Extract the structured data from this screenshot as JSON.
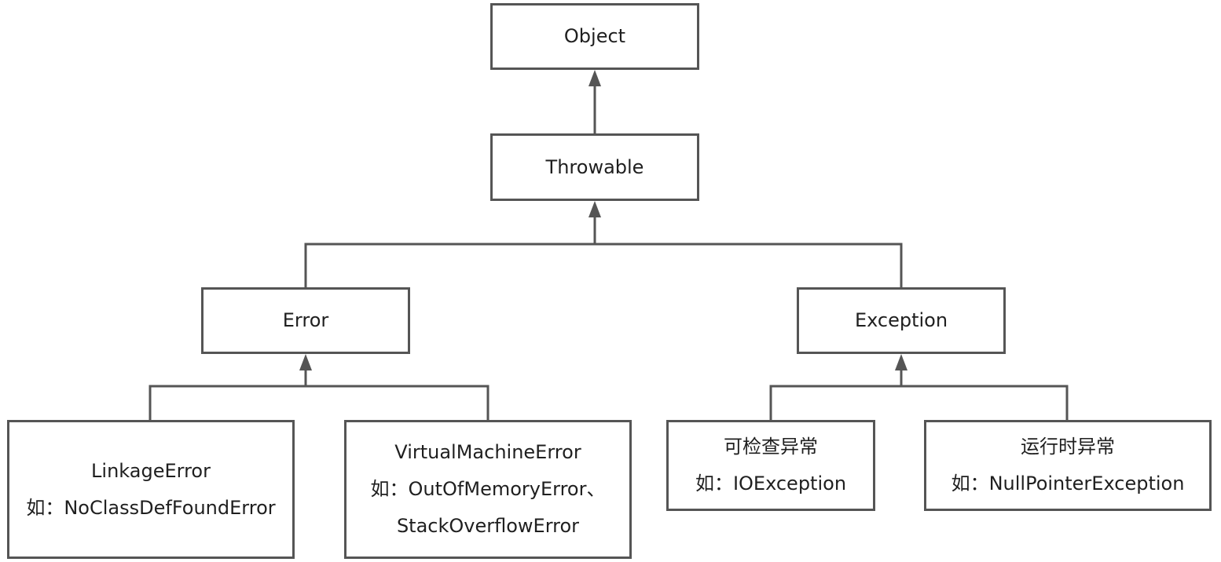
{
  "nodes": {
    "object": {
      "lines": [
        "Object"
      ]
    },
    "throwable": {
      "lines": [
        "Throwable"
      ]
    },
    "error": {
      "lines": [
        "Error"
      ]
    },
    "exception": {
      "lines": [
        "Exception"
      ]
    },
    "linkage_error": {
      "lines": [
        "LinkageError",
        "如：NoClassDefFoundError"
      ]
    },
    "vm_error": {
      "lines": [
        "VirtualMachineError",
        "如：OutOfMemoryError、",
        "StackOverflowError"
      ]
    },
    "checked_exception": {
      "lines": [
        "可检查异常",
        "如：IOException"
      ]
    },
    "runtime_exception": {
      "lines": [
        "运行时异常",
        "如：NullPointerException"
      ]
    }
  },
  "colors": {
    "stroke": "#555555",
    "text": "#1f1f1f",
    "background": "#ffffff"
  }
}
